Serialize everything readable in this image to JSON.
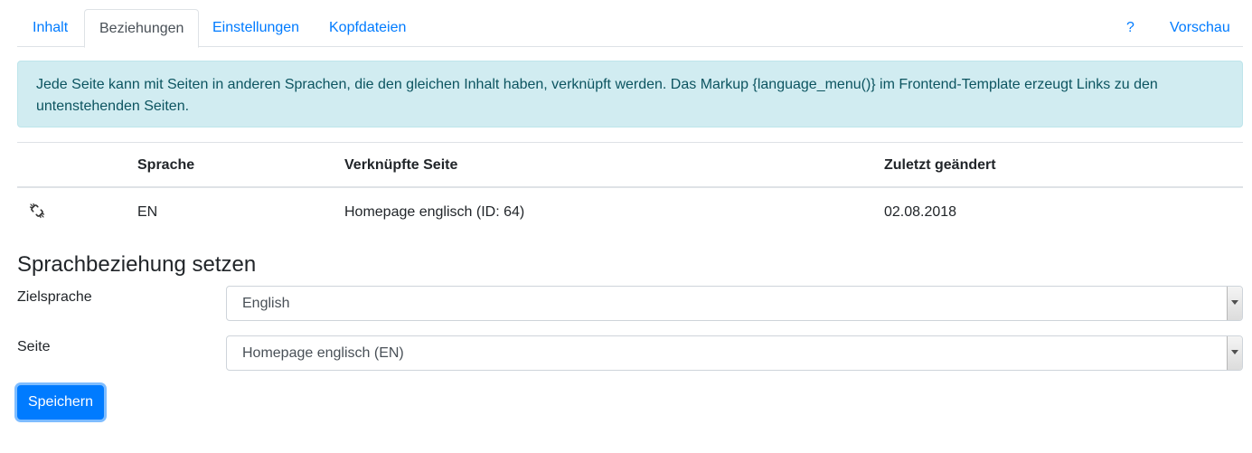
{
  "tabs": {
    "inhalt": "Inhalt",
    "beziehungen": "Beziehungen",
    "einstellungen": "Einstellungen",
    "kopfdateien": "Kopfdateien",
    "help": "?",
    "vorschau": "Vorschau",
    "active": "beziehungen"
  },
  "info": {
    "text": "Jede Seite kann mit Seiten in anderen Sprachen, die den gleichen Inhalt haben, verknüpft werden. Das Markup {language_menu()} im Frontend-Template erzeugt Links zu den untenstehenden Seiten."
  },
  "relations_table": {
    "headers": {
      "action": "",
      "language": "Sprache",
      "linked_page": "Verknüpfte Seite",
      "last_changed": "Zuletzt geändert"
    },
    "rows": [
      {
        "action_icon": "unlink-icon",
        "language": "EN",
        "linked_page": "Homepage englisch (ID: 64)",
        "last_changed": "02.08.2018"
      }
    ]
  },
  "form": {
    "title": "Sprachbeziehung setzen",
    "target_language_label": "Zielsprache",
    "target_language_value": "English",
    "page_label": "Seite",
    "page_value": "Homepage englisch (EN)",
    "save_label": "Speichern"
  },
  "colors": {
    "link": "#007bff",
    "info_bg": "#d1ecf1",
    "info_text": "#0c5460",
    "primary": "#007bff"
  }
}
